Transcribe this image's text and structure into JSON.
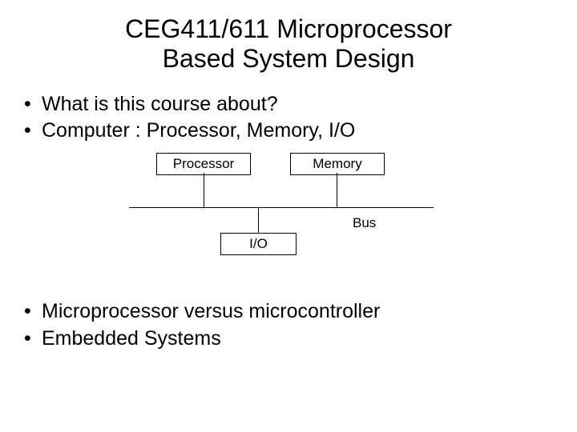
{
  "title_line1": "CEG411/611 Microprocessor",
  "title_line2": "Based System Design",
  "bullets_top": [
    "What is this course about?",
    "Computer : Processor, Memory, I/O"
  ],
  "diagram": {
    "processor_label": "Processor",
    "memory_label": "Memory",
    "io_label": "I/O",
    "bus_label": "Bus"
  },
  "bullets_bottom": [
    "Microprocessor versus microcontroller",
    "Embedded Systems"
  ]
}
